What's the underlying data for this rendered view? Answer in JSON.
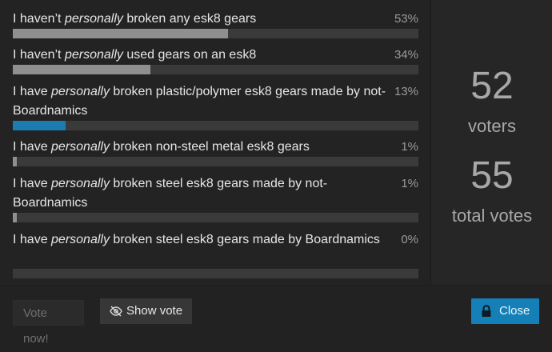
{
  "poll": {
    "options": [
      {
        "before": "I haven’t ",
        "em": "personally",
        "after": " broken any esk8 gears",
        "percent_label": "53%",
        "percent": 53,
        "chosen": false
      },
      {
        "before": "I haven’t ",
        "em": "personally",
        "after": " used gears on an esk8",
        "percent_label": "34%",
        "percent": 34,
        "chosen": false
      },
      {
        "before": "I have ",
        "em": "personally",
        "after": " broken plastic/polymer esk8 gears made by not-Boardnamics",
        "percent_label": "13%",
        "percent": 13,
        "chosen": true
      },
      {
        "before": "I have ",
        "em": "personally",
        "after": " broken non-steel metal esk8 gears",
        "percent_label": "1%",
        "percent": 1,
        "chosen": false
      },
      {
        "before": "I have ",
        "em": "personally",
        "after": " broken steel esk8 gears made by not-Boardnamics",
        "percent_label": "1%",
        "percent": 1,
        "chosen": false
      },
      {
        "before": "I have ",
        "em": "personally",
        "after": " broken steel esk8 gears made by Boardnamics",
        "percent_label": "0%",
        "percent": 0,
        "chosen": false
      }
    ],
    "stats": {
      "voters": "52",
      "voters_label": "voters",
      "total_votes": "55",
      "total_votes_label": "total votes"
    }
  },
  "footer": {
    "vote_label": "Vote now!",
    "show_vote_label": "Show vote",
    "close_label": "Close"
  },
  "colors": {
    "accent": "#1580b8",
    "chosen_bar": "#1d7bb1",
    "bar": "#8f8f8f",
    "track": "#3a3a3a"
  }
}
